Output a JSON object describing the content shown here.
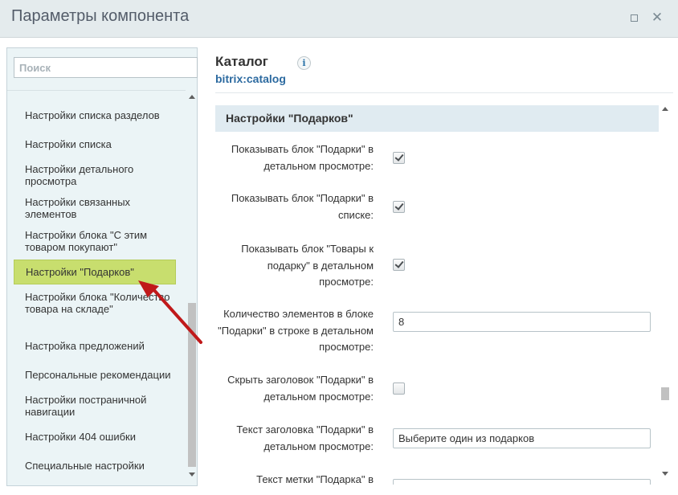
{
  "window": {
    "title": "Параметры компонента"
  },
  "sidebar": {
    "search_placeholder": "Поиск",
    "items": [
      {
        "label": "Настройки списка разделов",
        "active": false
      },
      {
        "label": "Настройки списка",
        "active": false
      },
      {
        "label": "Настройки детального просмотра",
        "active": false
      },
      {
        "label": "Настройки связанных элементов",
        "active": false
      },
      {
        "label": "Настройки блока \"С этим товаром покупают\"",
        "active": false
      },
      {
        "label": "Настройки \"Подарков\"",
        "active": true
      },
      {
        "label": "Настройки блока \"Количество товара на складе\"",
        "active": false
      },
      {
        "label": "Настройка предложений",
        "active": false
      },
      {
        "label": "Персональные рекомендации",
        "active": false
      },
      {
        "label": "Настройки постраничной навигации",
        "active": false
      },
      {
        "label": "Настройки 404 ошибки",
        "active": false
      },
      {
        "label": "Специальные настройки",
        "active": false
      }
    ]
  },
  "component": {
    "title": "Каталог",
    "code": "bitrix:catalog",
    "info_glyph": "i"
  },
  "section": {
    "title": "Настройки \"Подарков\"",
    "params": [
      {
        "label": "Показывать блок \"Подарки\" в детальном просмотре:",
        "type": "checkbox",
        "checked": true
      },
      {
        "label": "Показывать блок \"Подарки\" в списке:",
        "type": "checkbox",
        "checked": true
      },
      {
        "label": "Показывать блок \"Товары к подарку\" в детальном просмотре:",
        "type": "checkbox",
        "checked": true
      },
      {
        "label": "Количество элементов в блоке \"Подарки\" в строке в детальном просмотре:",
        "type": "text",
        "value": "8"
      },
      {
        "label": "Скрыть заголовок \"Подарки\" в детальном просмотре:",
        "type": "checkbox",
        "checked": false
      },
      {
        "label": "Текст заголовка \"Подарки\" в детальном просмотре:",
        "type": "text",
        "value": "Выберите один из подарков"
      },
      {
        "label": "Текст метки \"Подарка\" в",
        "type": "text",
        "value": ""
      }
    ]
  },
  "colors": {
    "active_item": "#c8de6e",
    "section_header": "#e0ebf1",
    "link": "#2c6aa0",
    "annotation_arrow": "#c0191a"
  }
}
